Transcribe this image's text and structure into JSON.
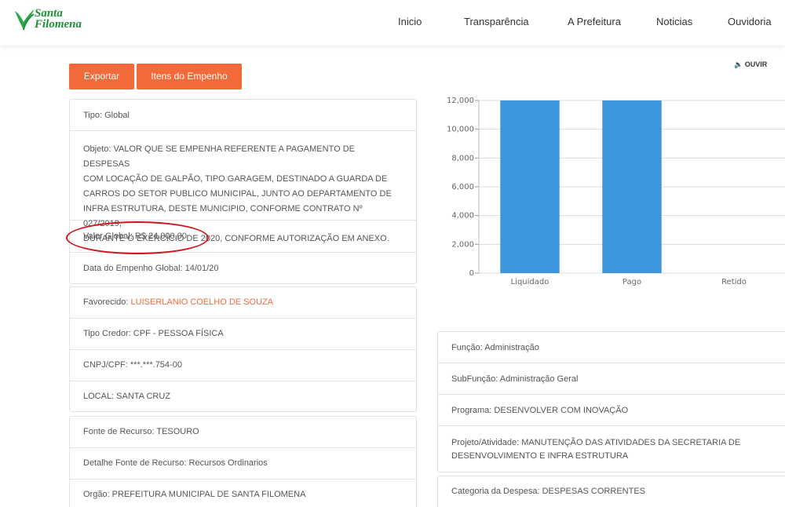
{
  "header": {
    "logo_line1": "Santa",
    "logo_line2": "Filomena",
    "logo_icon": "heart-leaf-logo",
    "nav": [
      "Inicio",
      "Transparência",
      "A Prefeitura",
      "Noticias",
      "Ouvidoria"
    ]
  },
  "toolbar": {
    "export_label": "Exportar",
    "items_label": "Itens do Empenho",
    "listen_label": "OUVIR",
    "listen_icon": "speaker-icon"
  },
  "left_panel_1": {
    "tipo": "Tipo: Global",
    "objeto_lines": [
      "Objeto: VALOR QUE SE EMPENHA REFERENTE A PAGAMENTO DE DESPESAS",
      "COM LOCAÇÃO DE GALPÃO, TIPO GARAGEM, DESTINADO A GUARDA DE",
      "CARROS DO SETOR PUBLICO MUNICIPAL, JUNTO AO DEPARTAMENTO DE",
      "INFRA ESTRUTURA, DESTE MUNICIPIO, CONFORME CONTRATO Nº 027/2019,",
      "DURANTE O EXERCÍCIO DE 2020, CONFORME AUTORIZAÇÃO EM ANEXO."
    ],
    "valor_global": "Valor Global: R$ 24.000,00",
    "data_empenho": "Data do Empenho Global: 14/01/20"
  },
  "left_panel_2": {
    "favorecido_label": "Favorecido: ",
    "favorecido_value": "LUISERLANIO COELHO DE SOUZA",
    "tipo_credor": "Tipo Credor: CPF - PESSOA FÍSICA",
    "cnpj_cpf": "CNPJ/CPF: ***.***.754-00",
    "local": "LOCAL: SANTA CRUZ"
  },
  "left_panel_3": {
    "fonte": "Fonte de Recurso: TESOURO",
    "detalhe_fonte": "Detalhe Fonte de Recurso: Recursos Ordinarios",
    "orgao": "Orgão: PREFEITURA MUNICIPAL DE SANTA FILOMENA"
  },
  "right_panel_1": {
    "funcao": "Função: Administração",
    "subfuncao": "SubFunção: Administração Geral",
    "programa": "Programa: DESENVOLVER COM INOVAÇÃO",
    "projeto_lines": [
      "Projeto/Atividade: MANUTENÇÃO DAS ATIVIDADES DA SECRETARIA DE",
      "DESENVOLVIMENTO E INFRA ESTRUTURA"
    ]
  },
  "right_panel_2": {
    "categoria": "Categoria da Despesa: DESPESAS CORRENTES"
  },
  "colors": {
    "accent": "#f26a3a",
    "bar": "#3a96dd",
    "highlight": "#d0161b",
    "logo_green": "#1f8f3a"
  },
  "chart_data": {
    "type": "bar",
    "categories": [
      "Liquidado",
      "Pago",
      "Retido"
    ],
    "values": [
      12000,
      12000,
      0
    ],
    "ylim": [
      0,
      12000
    ],
    "yticks": [
      0,
      2000,
      4000,
      6000,
      8000,
      10000,
      12000
    ],
    "ytick_labels": [
      "0",
      "2,000",
      "4,000",
      "6,000",
      "8,000",
      "10,000",
      "12,000"
    ],
    "grid": true,
    "title": "",
    "xlabel": "",
    "ylabel": ""
  }
}
